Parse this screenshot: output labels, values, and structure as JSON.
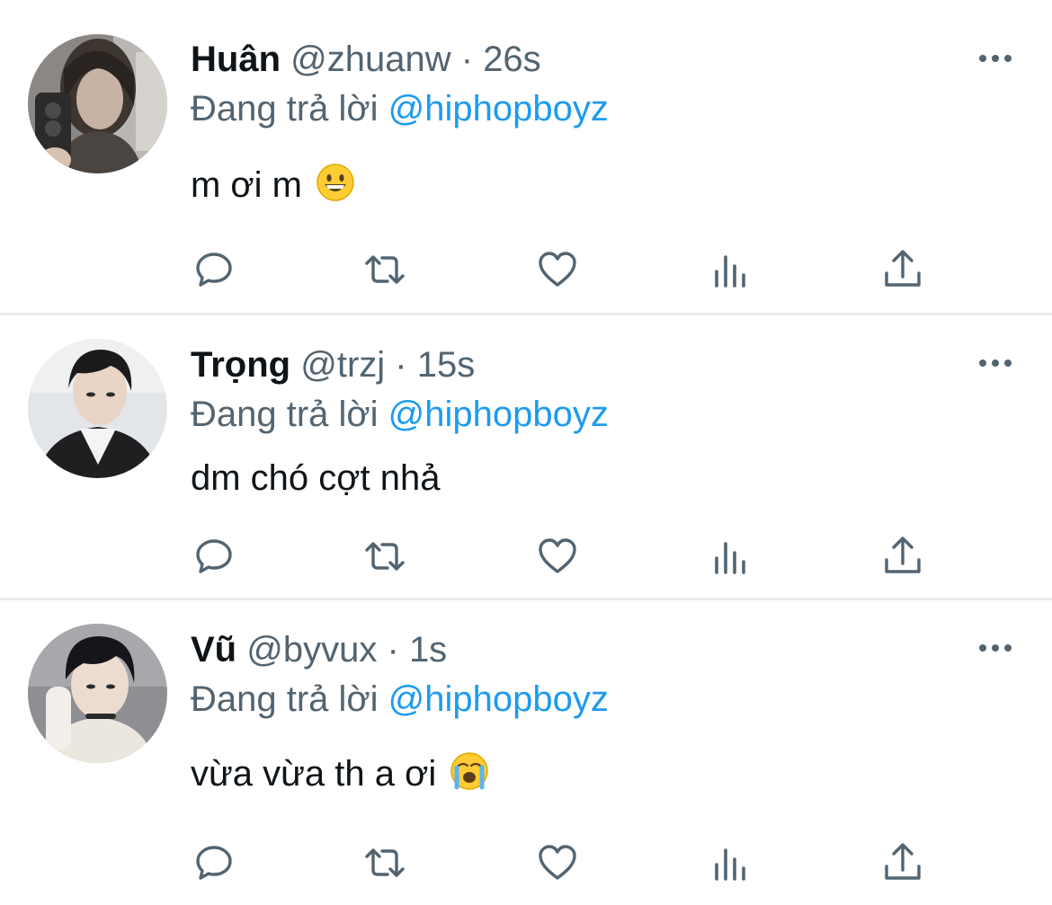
{
  "reply_prefix": "Đang trả lời",
  "icon_color": "#536471",
  "accent_color": "#1d9bf0",
  "tweets": [
    {
      "name": "Huân",
      "handle": "@zhuanw",
      "dot": "·",
      "time": "26s",
      "reply_to": "@hiphopboyz",
      "text": "m ơi m",
      "emoji": "grinning-face-emoji"
    },
    {
      "name": "Trọng",
      "handle": "@trzj",
      "dot": "·",
      "time": "15s",
      "reply_to": "@hiphopboyz",
      "text": "dm chó cợt nhả",
      "emoji": ""
    },
    {
      "name": "Vũ",
      "handle": "@byvux",
      "dot": "·",
      "time": "1s",
      "reply_to": "@hiphopboyz",
      "text": "vừa vừa th a ơi",
      "emoji": "loudly-crying-face-emoji"
    }
  ],
  "actions": [
    "reply-icon",
    "retweet-icon",
    "like-icon",
    "views-icon",
    "share-icon"
  ]
}
